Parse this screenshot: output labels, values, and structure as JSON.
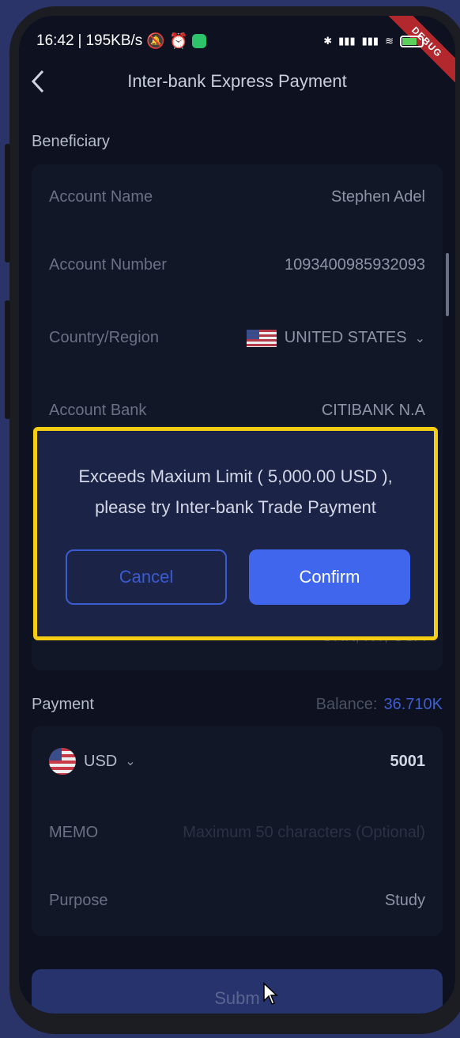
{
  "status_bar": {
    "time": "16:42",
    "speed": "195KB/s",
    "battery": "76",
    "debug": "DEBUG"
  },
  "nav": {
    "title": "Inter-bank Express Payment",
    "back_icon": "chevron-left-icon"
  },
  "beneficiary": {
    "section_title": "Beneficiary",
    "rows": [
      {
        "label": "Account Name",
        "value": "Stephen Adel"
      },
      {
        "label": "Account Number",
        "value": "1093400985932093"
      },
      {
        "label": "Country/Region",
        "value": "UNITED STATES"
      },
      {
        "label": "Account Bank",
        "value": "CITIBANK N.A"
      }
    ],
    "partial_address": "ORK, NY, USA"
  },
  "payment": {
    "section_title": "Payment",
    "balance_label": "Balance:",
    "balance_value": "36.710K",
    "currency": "USD",
    "amount": "5001",
    "memo_label": "MEMO",
    "memo_placeholder": "Maximum 50 characters (Optional)",
    "purpose_label": "Purpose",
    "purpose_value": "Study"
  },
  "submit_label": "Subm",
  "dialog": {
    "message_line1": "Exceeds Maxium Limit ( 5,000.00 USD ),",
    "message_line2": "please try Inter-bank Trade Payment",
    "cancel_label": "Cancel",
    "confirm_label": "Confirm"
  },
  "colors": {
    "accent": "#3f66ec",
    "highlight": "#f5ce14",
    "balance": "#3f5ed0"
  }
}
